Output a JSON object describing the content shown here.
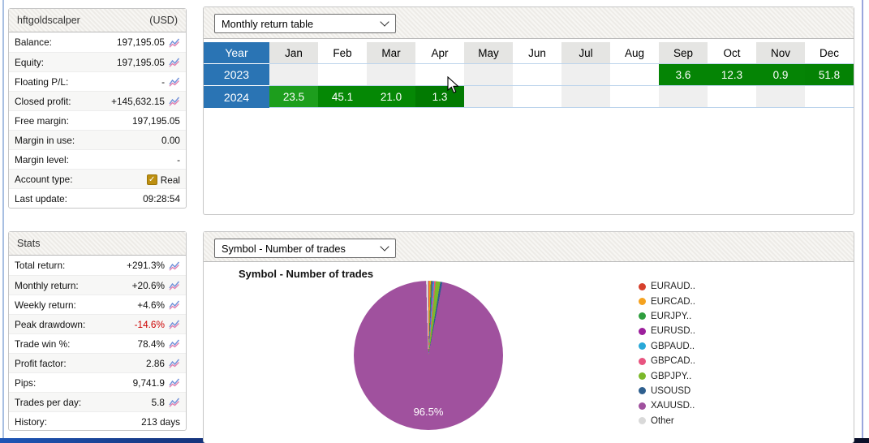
{
  "account_panel": {
    "title": "hftgoldscalper",
    "currency": "(USD)",
    "rows": [
      {
        "label": "Balance:",
        "value": "197,195.05",
        "icon": "chart"
      },
      {
        "label": "Equity:",
        "value": "197,195.05",
        "icon": "chart"
      },
      {
        "label": "Floating P/L:",
        "value": "-",
        "icon": "chart"
      },
      {
        "label": "Closed profit:",
        "value": "+145,632.15",
        "icon": "chart"
      },
      {
        "label": "Free margin:",
        "value": "197,195.05"
      },
      {
        "label": "Margin in use:",
        "value": "0.00"
      },
      {
        "label": "Margin level:",
        "value": "-"
      },
      {
        "label": "Account type:",
        "value": "Real",
        "checkbox": true
      },
      {
        "label": "Last update:",
        "value": "09:28:54"
      }
    ]
  },
  "stats_panel": {
    "title": "Stats",
    "rows": [
      {
        "label": "Total return:",
        "value": "+291.3%",
        "icon": "chart"
      },
      {
        "label": "Monthly return:",
        "value": "+20.6%",
        "icon": "chart"
      },
      {
        "label": "Weekly return:",
        "value": "+4.6%",
        "icon": "chart"
      },
      {
        "label": "Peak drawdown:",
        "value": "-14.6%",
        "icon": "chart",
        "value_color": "#cc0000"
      },
      {
        "label": "Trade win %:",
        "value": "78.4%",
        "icon": "chart"
      },
      {
        "label": "Profit factor:",
        "value": "2.86",
        "icon": "chart"
      },
      {
        "label": "Pips:",
        "value": "9,741.9",
        "icon": "chart"
      },
      {
        "label": "Trades per day:",
        "value": "5.8",
        "icon": "chart"
      },
      {
        "label": "History:",
        "value": "213 days"
      }
    ]
  },
  "monthly_panel": {
    "selector_value": "Monthly return table"
  },
  "symbol_panel": {
    "selector_value": "Symbol - Number of trades"
  },
  "chart_data": [
    {
      "type": "table",
      "title": "Monthly return table",
      "columns": [
        "Year",
        "Jan",
        "Feb",
        "Mar",
        "Apr",
        "May",
        "Jun",
        "Jul",
        "Aug",
        "Sep",
        "Oct",
        "Nov",
        "Dec"
      ],
      "year_header_color": "#2a74b4",
      "rows": [
        {
          "year": "2023",
          "cells": [
            "",
            "",
            "",
            "",
            "",
            "",
            "",
            "",
            "3.6",
            "12.3",
            "0.9",
            "51.8"
          ],
          "cell_colors": [
            "",
            "",
            "",
            "",
            "",
            "",
            "",
            "",
            "#058405",
            "#058405",
            "#058405",
            "#048204"
          ]
        },
        {
          "year": "2024",
          "cells": [
            "23.5",
            "45.1",
            "21.0",
            "1.3",
            "",
            "",
            "",
            "",
            "",
            "",
            "",
            ""
          ],
          "cell_colors": [
            "#1d9e1d",
            "#058805",
            "#058805",
            "#027a02",
            "",
            "",
            "",
            "",
            "",
            "",
            "",
            ""
          ]
        }
      ]
    },
    {
      "type": "pie",
      "title": "Symbol - Number of trades",
      "labels": [
        "EURAUD..",
        "EURCAD..",
        "EURJPY..",
        "EURUSD..",
        "GBPAUD..",
        "GBPCAD..",
        "GBPJPY..",
        "USOUSD",
        "XAUUSD..",
        "Other"
      ],
      "values_pct": [
        0.2,
        0.3,
        0.25,
        0.2,
        0.3,
        0.3,
        1.0,
        0.45,
        96.5,
        0.5
      ],
      "colors": [
        "#d6402c",
        "#f5a21f",
        "#2f9e3e",
        "#9c1f9c",
        "#28a8d8",
        "#e85480",
        "#7cb92a",
        "#2e5f8e",
        "#a0519e",
        "#d9d9d9"
      ],
      "data_label": "96.5%",
      "data_label_slice": "XAUUSD..",
      "legend_position": "right"
    }
  ]
}
